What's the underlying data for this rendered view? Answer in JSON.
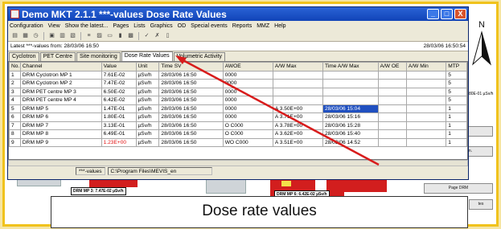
{
  "window": {
    "title": "Demo MKT 2.1.1 ***-values  Dose Rate Values",
    "minimize": "_",
    "maximize": "□",
    "close": "X"
  },
  "menu": [
    "Configuration",
    "View",
    "Show the latest...",
    "Pages",
    "Lists",
    "Graphics",
    "OD",
    "Special events",
    "Reports",
    "MMZ",
    "Help"
  ],
  "info": {
    "latest": "Latest ***-values from: 28/03/06 16:50",
    "timestamp": "28/03/06 16:50:54"
  },
  "tabs": [
    "Cyclotron",
    "PET Centre",
    "Site monitoring",
    "Dose Rate Values",
    "Volumetric Activity"
  ],
  "table": {
    "headers": [
      "No.",
      "Channel",
      "Value",
      "Unit",
      "Time",
      "AWOE",
      "A/W Max",
      "Time A/W Max",
      "A/W OE",
      "A/W Min",
      "MTP"
    ],
    "header_time_suffix": "SV",
    "rows": [
      [
        "1",
        "DRM Cyclotron MP 1",
        "7.61E-02",
        "µSv/h",
        "28/03/06 16:50",
        "0000",
        "",
        "",
        "",
        "",
        "5"
      ],
      [
        "2",
        "DRM Cyclotron MP 2",
        "7.47E-02",
        "µSv/h",
        "28/03/06 16:50",
        "0000",
        "",
        "",
        "",
        "",
        "5"
      ],
      [
        "3",
        "DRM PET centre MP 3",
        "6.50E-02",
        "µSv/h",
        "28/03/06 16:50",
        "0000",
        "",
        "",
        "",
        "",
        "5"
      ],
      [
        "4",
        "DRM PET centre MP 4",
        "6.42E-02",
        "µSv/h",
        "28/03/06 16:50",
        "0000",
        "",
        "",
        "",
        "",
        "5"
      ],
      [
        "5",
        "DRM MP 5",
        "1.47E-01",
        "µSv/h",
        "28/03/06 16:50",
        "0000",
        "A  3.50E+00",
        "28/03/06 15:04",
        "",
        "",
        "1"
      ],
      [
        "6",
        "DRM MP 6",
        "1.80E-01",
        "µSv/h",
        "28/03/06 16:50",
        "0000",
        "A  3.71E+00",
        "28/03/06 15:16",
        "",
        "",
        "1"
      ],
      [
        "7",
        "DRM MP 7",
        "3.13E-01",
        "µSv/h",
        "28/03/06 16:50",
        "O  C000",
        "A  3.78E+00",
        "28/03/06 15:28",
        "",
        "",
        "1"
      ],
      [
        "8",
        "DRM MP 8",
        "6.49E-01",
        "µSv/h",
        "28/03/06 16:50",
        "O  C000",
        "A  3.62E+00",
        "28/03/06 15:40",
        "",
        "",
        "1"
      ],
      [
        "9",
        "DRM MP 9",
        "1.23E+00",
        "µSv/h",
        "28/03/06 16:50",
        "WO  C000",
        "A  3.51E+00",
        "28/03/06 14:52",
        "",
        "",
        "1"
      ]
    ]
  },
  "status": {
    "left": "***-values",
    "path": "C:\\Program Files\\MEVIS_en"
  },
  "map": {
    "label1": "DRM MP 3: 7.47E-02 µSv/h",
    "label2": "DRM MP 6: 6.42E-02 µSv/h",
    "label3": "80E-01 µSv/h",
    "north": "N",
    "buttons": [
      "Page PET",
      "Page Site mon.",
      "Page DRM",
      "tes"
    ]
  },
  "caption": "Dose rate values",
  "colors": {
    "accent_red": "#e01010",
    "highlight": "#2050c0",
    "frame": "#f0c21c"
  }
}
